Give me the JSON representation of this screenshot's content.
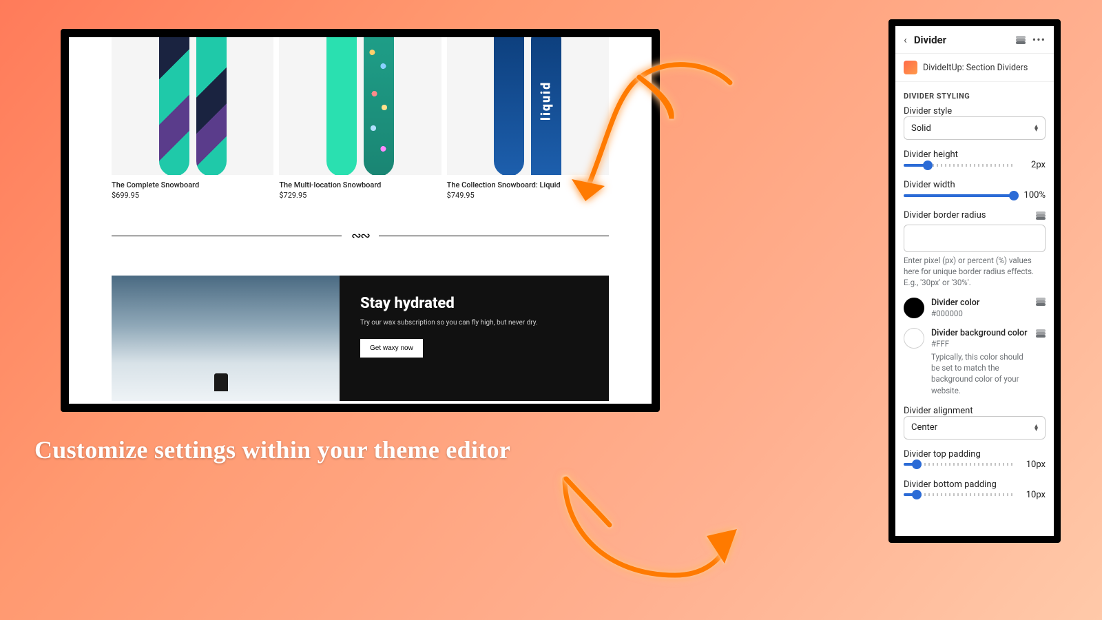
{
  "caption": "Customize settings within your theme editor",
  "preview": {
    "products": [
      {
        "title": "The Complete Snowboard",
        "price": "$699.95"
      },
      {
        "title": "The Multi-location Snowboard",
        "price": "$729.95"
      },
      {
        "title": "The Collection Snowboard: Liquid",
        "price": "$749.95"
      }
    ],
    "hero": {
      "heading": "Stay hydrated",
      "sub": "Try our wax subscription so you can fly high, but never dry.",
      "cta": "Get waxy now"
    }
  },
  "panel": {
    "title": "Divider",
    "app_name": "DivideItUp: Section Dividers",
    "section_label": "DIVIDER STYLING",
    "style": {
      "label": "Divider style",
      "value": "Solid"
    },
    "height": {
      "label": "Divider height",
      "value": "2px",
      "pct": 22
    },
    "width": {
      "label": "Divider width",
      "value": "100%",
      "pct": 100
    },
    "radius": {
      "label": "Divider border radius",
      "value": "",
      "help": "Enter pixel (px) or percent (%) values here for unique border radius effects. E.g., '30px' or '30%'."
    },
    "color": {
      "label": "Divider color",
      "hex": "#000000"
    },
    "bgcolor": {
      "label": "Divider background color",
      "hex": "#FFF",
      "help": "Typically, this color should be set to match the background color of your website."
    },
    "alignment": {
      "label": "Divider alignment",
      "value": "Center"
    },
    "pad_top": {
      "label": "Divider top padding",
      "value": "10px",
      "pct": 12
    },
    "pad_bottom": {
      "label": "Divider bottom padding",
      "value": "10px",
      "pct": 12
    }
  }
}
